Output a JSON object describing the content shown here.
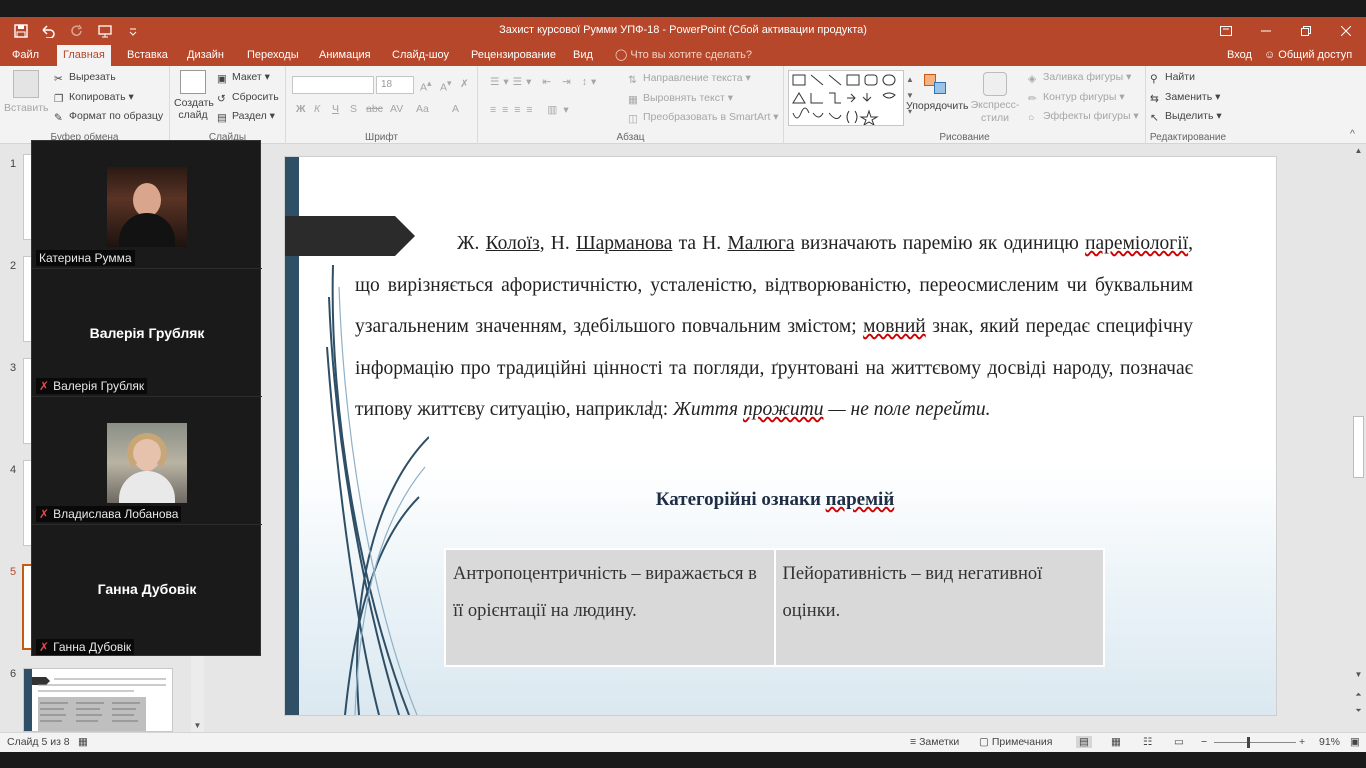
{
  "window": {
    "title": "Захист курсової Румми УПФ-18 - PowerPoint (Сбой активации продукта)",
    "accent": "#b7472a"
  },
  "quick_access": [
    "save-icon",
    "undo-icon",
    "redo-icon",
    "start-slideshow-icon",
    "customize-qat-icon"
  ],
  "tabs": [
    "Файл",
    "Главная",
    "Вставка",
    "Дизайн",
    "Переходы",
    "Анимация",
    "Слайд-шоу",
    "Рецензирование",
    "Вид"
  ],
  "active_tab": "Главная",
  "tell_me": "Что вы хотите сделать?",
  "account": {
    "signin": "Вход",
    "share": "Общий доступ"
  },
  "ribbon": {
    "clipboard": {
      "label": "Буфер обмена",
      "paste": "Вставить",
      "cut": "Вырезать",
      "copy": "Копировать",
      "format_painter": "Формат по образцу"
    },
    "slides": {
      "label": "Слайды",
      "new_slide_1": "Создать",
      "new_slide_2": "слайд",
      "layout": "Макет",
      "reset": "Сбросить",
      "section": "Раздел"
    },
    "font": {
      "label": "Шрифт",
      "size": "18",
      "bold": "Ж",
      "italic": "К",
      "underline": "Ч",
      "strike": "S",
      "spacing": "AV",
      "case": "Aa",
      "color": "A"
    },
    "paragraph": {
      "label": "Абзац",
      "text_direction": "Направление текста",
      "align_text": "Выровнять текст",
      "smartart": "Преобразовать в SmartArt"
    },
    "drawing": {
      "label": "Рисование",
      "arrange": "Упорядочить",
      "quick_styles_1": "Экспресс-",
      "quick_styles_2": "стили",
      "fill": "Заливка фигуры",
      "outline": "Контур фигуры",
      "effects": "Эффекты фигуры"
    },
    "editing": {
      "label": "Редактирование",
      "find": "Найти",
      "replace": "Заменить",
      "select": "Выделить"
    }
  },
  "thumbnails": [
    "1",
    "2",
    "3",
    "4",
    "5",
    "6"
  ],
  "active_slide": "5",
  "participants": [
    {
      "name": "Катерина Румма",
      "has_video": true
    },
    {
      "name": "Валерія Грубляк",
      "has_video": false
    },
    {
      "name": "Владислава Лобанова",
      "has_video": true
    },
    {
      "name": "Ганна Дубовік",
      "has_video": false
    }
  ],
  "slide": {
    "para_parts": {
      "p1": "Ж. ",
      "koloiz": "Колоїз",
      "p2": ", Н. ",
      "sharmanova": "Шарманова",
      "p3": " та Н. ",
      "maliuha": "Малюга",
      "p4": " визначають паремію як одиницю ",
      "paremiolohii": "пареміології",
      "p5": ", що вирізняється афористичністю, усталеністю, відтворюваністю, переосмисленим чи буквальним узагальненим значенням, здебільшого повчальним змістом; ",
      "movnyi": "мовний",
      "p6": " знак, який передає специфічну інформацію про традиційні цінності та погляди, ґрунтовані на життєвому досвіді народу, позначає типову життєву ситуацію, наприклад: ",
      "ex1": "Життя ",
      "ex_prozhyty": "прожити",
      "ex2": " — не поле перейти."
    },
    "heading_1": "Категорійні ознаки ",
    "heading_2": "паремій",
    "table": [
      "Антропоцентричність – виражається в її орієнтації на людину.",
      "Пейоративність – вид негативної оцінки."
    ]
  },
  "status": {
    "slide_counter": "Слайд 5 из 8",
    "notes": "Заметки",
    "comments": "Примечания",
    "zoom": "91%"
  }
}
